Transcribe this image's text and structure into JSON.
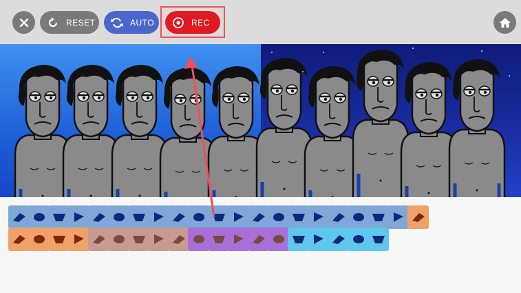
{
  "toolbar": {
    "reset_label": "RESET",
    "auto_label": "AUTO",
    "rec_label": "REC"
  },
  "colors": {
    "topbar": "#dcdcdc",
    "grey_button": "#7a7a7a",
    "auto_button": "#4a67c9",
    "rec_button": "#e01a22",
    "highlight": "#ee4f5b",
    "sound_blue": "#7fa8d8",
    "sound_orange": "#f0a16a",
    "sound_brown": "#c79a92",
    "sound_purple": "#a86fd9",
    "sound_cyan": "#5fc6ee"
  },
  "stage": {
    "characters": [
      "singer",
      "singer",
      "singer",
      "singer",
      "singer",
      "singer",
      "singer",
      "singer",
      "singer",
      "singer"
    ]
  },
  "sound_rows": {
    "row1": [
      "beat",
      "beat",
      "beat",
      "beat",
      "beat",
      "beat",
      "beat",
      "beat",
      "beat",
      "beat",
      "beat",
      "beat",
      "beat",
      "beat",
      "beat",
      "beat",
      "beat",
      "beat",
      "beat",
      "beat",
      "effect"
    ],
    "row2": [
      "effect",
      "effect",
      "effect",
      "effect",
      "melody",
      "melody",
      "melody",
      "melody",
      "melody",
      "melody",
      "melody",
      "melody",
      "melody",
      "melody",
      "vocal",
      "vocal",
      "vocal",
      "vocal",
      "vocal"
    ]
  }
}
